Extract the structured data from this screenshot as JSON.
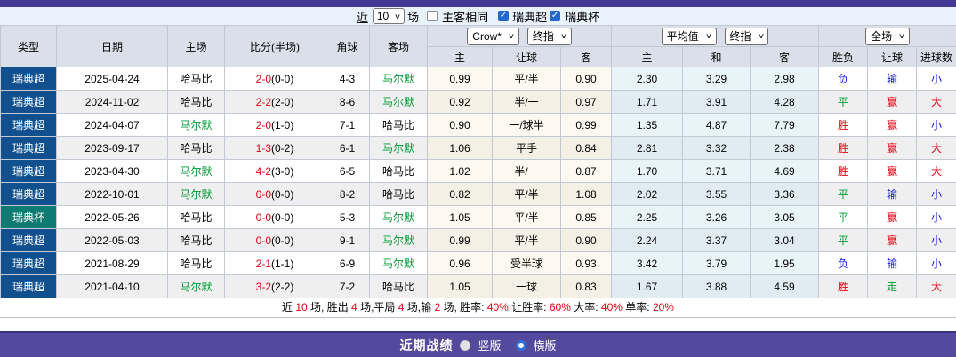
{
  "colors": {
    "accent_purple": "#54499c",
    "top_bar_purple": "#463895",
    "league_super_bg": "#11508f",
    "league_cup_bg": "#0e7b72",
    "win_red": "#e60012",
    "lose_blue": "#1414e6",
    "draw_green": "#009933",
    "team_green": "#009900",
    "filter_bar_bg": "#e9f1fb"
  },
  "filter": {
    "recent_label": "近",
    "count_value": "10",
    "games_label": "场",
    "same_venue_label": "主客相同",
    "same_venue_checked": false,
    "leagues": [
      {
        "label": "瑞典超",
        "checked": true
      },
      {
        "label": "瑞典杯",
        "checked": true
      }
    ]
  },
  "table": {
    "headers": [
      "类型",
      "日期",
      "主场",
      "比分(半场)",
      "角球",
      "客场"
    ],
    "dropdowns": {
      "company": "Crow*",
      "company_stage": "终指",
      "average": "平均值",
      "average_stage": "终指",
      "scope": "全场"
    },
    "sub_headers": [
      "主",
      "让球",
      "客",
      "主",
      "和",
      "客",
      "胜负",
      "让球",
      "进球数"
    ],
    "rows": [
      {
        "type": "瑞典超",
        "cup": false,
        "date": "2025-04-24",
        "home": "哈马比",
        "home_c": "black",
        "score": "2-0",
        "half": "(0-0)",
        "corner": "4-3",
        "away": "马尔默",
        "away_c": "green",
        "ho": "0.99",
        "hc": "平/半",
        "ao": "0.90",
        "eh": "2.30",
        "ed": "3.29",
        "ea": "2.98",
        "res": "负",
        "res_c": "blue",
        "hr": "输",
        "hr_c": "blue",
        "g": "小",
        "g_c": "blue"
      },
      {
        "type": "瑞典超",
        "cup": false,
        "date": "2024-11-02",
        "home": "哈马比",
        "home_c": "black",
        "score": "2-2",
        "half": "(2-0)",
        "corner": "8-6",
        "away": "马尔默",
        "away_c": "green",
        "ho": "0.92",
        "hc": "半/一",
        "ao": "0.97",
        "eh": "1.71",
        "ed": "3.91",
        "ea": "4.28",
        "res": "平",
        "res_c": "green",
        "hr": "赢",
        "hr_c": "red",
        "g": "大",
        "g_c": "red"
      },
      {
        "type": "瑞典超",
        "cup": false,
        "date": "2024-04-07",
        "home": "马尔默",
        "home_c": "green",
        "score": "2-0",
        "half": "(1-0)",
        "corner": "7-1",
        "away": "哈马比",
        "away_c": "black",
        "ho": "0.90",
        "hc": "一/球半",
        "ao": "0.99",
        "eh": "1.35",
        "ed": "4.87",
        "ea": "7.79",
        "res": "胜",
        "res_c": "red",
        "hr": "赢",
        "hr_c": "red",
        "g": "小",
        "g_c": "blue"
      },
      {
        "type": "瑞典超",
        "cup": false,
        "date": "2023-09-17",
        "home": "哈马比",
        "home_c": "black",
        "score": "1-3",
        "half": "(0-2)",
        "corner": "6-1",
        "away": "马尔默",
        "away_c": "green",
        "ho": "1.06",
        "hc": "平手",
        "ao": "0.84",
        "eh": "2.81",
        "ed": "3.32",
        "ea": "2.38",
        "res": "胜",
        "res_c": "red",
        "hr": "赢",
        "hr_c": "red",
        "g": "大",
        "g_c": "red"
      },
      {
        "type": "瑞典超",
        "cup": false,
        "date": "2023-04-30",
        "home": "马尔默",
        "home_c": "green",
        "score": "4-2",
        "half": "(3-0)",
        "corner": "6-5",
        "away": "哈马比",
        "away_c": "black",
        "ho": "1.02",
        "hc": "半/一",
        "ao": "0.87",
        "eh": "1.70",
        "ed": "3.71",
        "ea": "4.69",
        "res": "胜",
        "res_c": "red",
        "hr": "赢",
        "hr_c": "red",
        "g": "大",
        "g_c": "red"
      },
      {
        "type": "瑞典超",
        "cup": false,
        "date": "2022-10-01",
        "home": "马尔默",
        "home_c": "green",
        "score": "0-0",
        "half": "(0-0)",
        "corner": "8-2",
        "away": "哈马比",
        "away_c": "black",
        "ho": "0.82",
        "hc": "平/半",
        "ao": "1.08",
        "eh": "2.02",
        "ed": "3.55",
        "ea": "3.36",
        "res": "平",
        "res_c": "green",
        "hr": "输",
        "hr_c": "blue",
        "g": "小",
        "g_c": "blue"
      },
      {
        "type": "瑞典杯",
        "cup": true,
        "date": "2022-05-26",
        "home": "哈马比",
        "home_c": "black",
        "score": "0-0",
        "half": "(0-0)",
        "corner": "5-3",
        "away": "马尔默",
        "away_c": "green",
        "ho": "1.05",
        "hc": "平/半",
        "ao": "0.85",
        "eh": "2.25",
        "ed": "3.26",
        "ea": "3.05",
        "res": "平",
        "res_c": "green",
        "hr": "赢",
        "hr_c": "red",
        "g": "小",
        "g_c": "blue"
      },
      {
        "type": "瑞典超",
        "cup": false,
        "date": "2022-05-03",
        "home": "哈马比",
        "home_c": "black",
        "score": "0-0",
        "half": "(0-0)",
        "corner": "9-1",
        "away": "马尔默",
        "away_c": "green",
        "ho": "0.99",
        "hc": "平/半",
        "ao": "0.90",
        "eh": "2.24",
        "ed": "3.37",
        "ea": "3.04",
        "res": "平",
        "res_c": "green",
        "hr": "赢",
        "hr_c": "red",
        "g": "小",
        "g_c": "blue"
      },
      {
        "type": "瑞典超",
        "cup": false,
        "date": "2021-08-29",
        "home": "哈马比",
        "home_c": "black",
        "score": "2-1",
        "half": "(1-1)",
        "corner": "6-9",
        "away": "马尔默",
        "away_c": "green",
        "ho": "0.96",
        "hc": "受半球",
        "ao": "0.93",
        "eh": "3.42",
        "ed": "3.79",
        "ea": "1.95",
        "res": "负",
        "res_c": "blue",
        "hr": "输",
        "hr_c": "blue",
        "g": "小",
        "g_c": "blue"
      },
      {
        "type": "瑞典超",
        "cup": false,
        "date": "2021-04-10",
        "home": "马尔默",
        "home_c": "green",
        "score": "3-2",
        "half": "(2-2)",
        "corner": "7-2",
        "away": "哈马比",
        "away_c": "black",
        "ho": "1.05",
        "hc": "一球",
        "ao": "0.83",
        "eh": "1.67",
        "ed": "3.88",
        "ea": "4.59",
        "res": "胜",
        "res_c": "red",
        "hr": "走",
        "hr_c": "green",
        "g": "大",
        "g_c": "red"
      }
    ]
  },
  "summary": {
    "parts": [
      {
        "t": "近 ",
        "c": "black"
      },
      {
        "t": "10",
        "c": "red"
      },
      {
        "t": " 场, 胜出 ",
        "c": "black"
      },
      {
        "t": "4",
        "c": "red"
      },
      {
        "t": " 场,平局 ",
        "c": "black"
      },
      {
        "t": "4",
        "c": "red"
      },
      {
        "t": " 场,输 ",
        "c": "black"
      },
      {
        "t": "2",
        "c": "red"
      },
      {
        "t": " 场, 胜率: ",
        "c": "black"
      },
      {
        "t": "40%",
        "c": "red"
      },
      {
        "t": " 让胜率: ",
        "c": "black"
      },
      {
        "t": "60%",
        "c": "red"
      },
      {
        "t": " 大率: ",
        "c": "black"
      },
      {
        "t": "40%",
        "c": "red"
      },
      {
        "t": " 单率: ",
        "c": "black"
      },
      {
        "t": "20%",
        "c": "red"
      }
    ]
  },
  "footer": {
    "title": "近期战绩",
    "options": [
      {
        "label": "竖版",
        "selected": true
      },
      {
        "label": "横版",
        "selected": false
      }
    ]
  },
  "glyphs": {
    "check": "✓",
    "chevron": "∨"
  }
}
